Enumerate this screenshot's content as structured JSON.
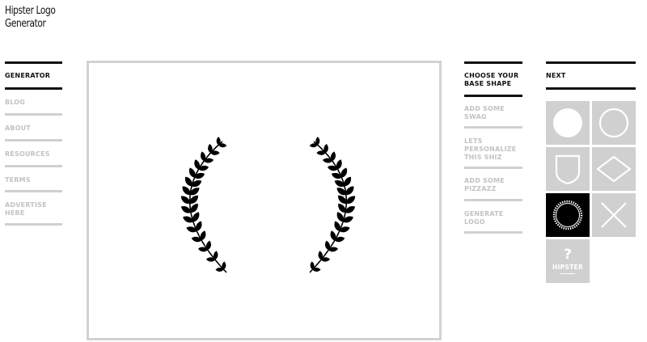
{
  "app": {
    "title_line1": "Hipster Logo",
    "title_line2": "Generator"
  },
  "left_nav": {
    "items": [
      {
        "label": "Generator",
        "active": true
      },
      {
        "label": "Blog",
        "active": false
      },
      {
        "label": "About",
        "active": false
      },
      {
        "label": "Resources",
        "active": false
      },
      {
        "label": "Terms",
        "active": false
      },
      {
        "label": "Advertise here",
        "active": false
      }
    ]
  },
  "steps": {
    "items": [
      {
        "label": "Choose your base shape",
        "active": true
      },
      {
        "label": "Add some swag",
        "active": false
      },
      {
        "label": "Lets personalize this shiz",
        "active": false
      },
      {
        "label": "Add some pizzazz",
        "active": false
      },
      {
        "label": "Generate logo",
        "active": false
      }
    ]
  },
  "next": {
    "label": "Next"
  },
  "shapes": {
    "items": [
      {
        "name": "filled-circle-icon",
        "selected": false
      },
      {
        "name": "circle-outline-icon",
        "selected": false
      },
      {
        "name": "shield-icon",
        "selected": false
      },
      {
        "name": "diamond-icon",
        "selected": false
      },
      {
        "name": "dotted-circle-icon",
        "selected": true
      },
      {
        "name": "x-icon",
        "selected": false
      }
    ],
    "random": {
      "symbol": "?",
      "label": "HIPSTER"
    }
  },
  "canvas": {
    "preview": "laurel-wreath-icon"
  },
  "colors": {
    "active_text": "#111111",
    "inactive_text": "#c2c2c2",
    "tile_bg": "#d0d0d0",
    "selected_tile_bg": "#000000"
  }
}
